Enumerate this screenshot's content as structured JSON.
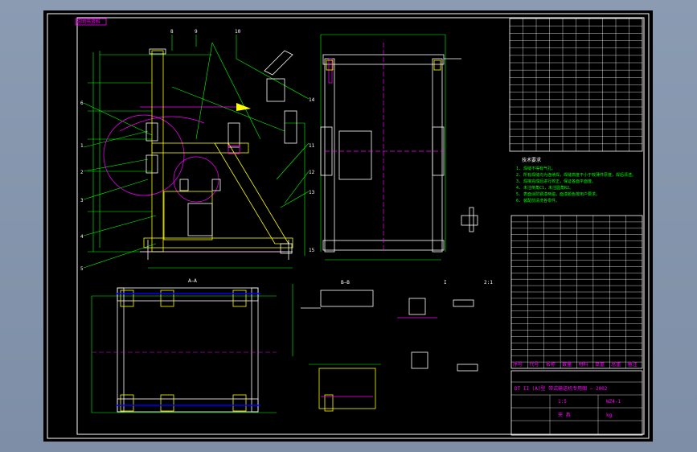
{
  "drawing": {
    "title_tag": "说明书资料",
    "section_label": "B—B",
    "view_label": "A—A",
    "notes_title": "技术要求",
    "notes": [
      "1. 焊缝不得有气孔。",
      "2. 所有焊缝均为连续焊，焊缝高度不小于较薄件厚度，焊后清渣。",
      "3. 焊接完成后进行校正，保证各面平面度。",
      "4. 未注倒角C1，未注圆角R2。",
      "5. 表面涂防锈漆两遍，面漆颜色按用户要求。",
      "6. 装配前清洗各零件。"
    ],
    "detail_label": "I",
    "scale_note": "2:1"
  },
  "title_block": {
    "scale": "1:5",
    "drawing_no": "WZ4-1",
    "name": "夹 具",
    "project": "DT II (A)型 带式输送机专用图 — 2002",
    "weight": "kg"
  },
  "table_headers": [
    "序号",
    "代号",
    "名称",
    "数量",
    "材料",
    "单重",
    "总重",
    "备注"
  ],
  "colors": {
    "background": "#000000",
    "frame": "#ffffff",
    "part": "#ffffff",
    "dimension": "#00ff00",
    "annotation": "#ff00ff",
    "hatching": "#ffff00",
    "center": "#0000ff"
  }
}
